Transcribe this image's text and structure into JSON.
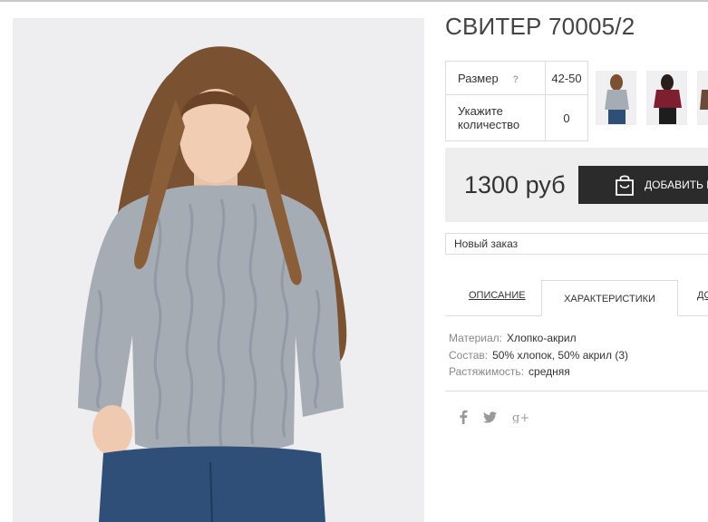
{
  "product": {
    "title": "СВИТЕР 70005/2",
    "size_label": "Размер",
    "size_help": "?",
    "size_value": "42-50",
    "qty_label": "Укажите количество",
    "qty_value": "0",
    "price": "1300 руб",
    "buy_label": "ДОБАВИТЬ В"
  },
  "order": {
    "selected": "Новый заказ"
  },
  "tabs": [
    {
      "label": "ОПИСАНИЕ"
    },
    {
      "label": "ХАРАКТЕРИСТИКИ"
    },
    {
      "label": "ДО"
    }
  ],
  "specs": [
    {
      "key": "Материал:",
      "value": "Хлопко-акрил"
    },
    {
      "key": "Состав:",
      "value": "50% хлопок, 50% акрил (3)"
    },
    {
      "key": "Растяжимость:",
      "value": "средняя"
    }
  ],
  "social": [
    {
      "icon": "facebook-icon",
      "glyph": "f"
    },
    {
      "icon": "twitter-icon",
      "glyph": "🐦"
    },
    {
      "icon": "google-plus-icon",
      "glyph": "g+"
    }
  ],
  "colors": {
    "sweater": "#a5acb4",
    "hair": "#7a5232",
    "jeans": "#2f4f78",
    "button": "#2b2b2b"
  }
}
